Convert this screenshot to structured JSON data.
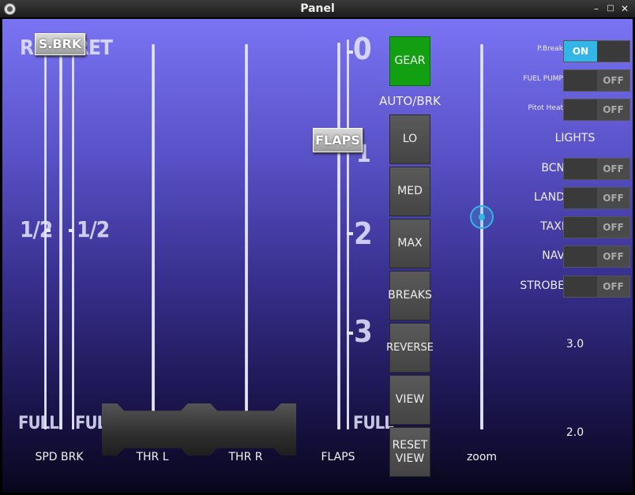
{
  "window": {
    "title": "Panel"
  },
  "speedbrake": {
    "knob": "S.BRK",
    "scale_left": "RET",
    "scale_right": "RET",
    "half_left": "1/2",
    "half_right": "1/2",
    "full_left": "FULL",
    "full_right": "FULL",
    "label": "SPD BRK"
  },
  "throttle": {
    "left_label": "THR L",
    "right_label": "THR R"
  },
  "flaps": {
    "knob": "FLAPS",
    "marks": [
      "0",
      "1",
      "2",
      "3"
    ],
    "full": "FULL",
    "label": "FLAPS"
  },
  "buttons": {
    "gear": "GEAR",
    "autobrk_label": "AUTO/BRK",
    "lo": "LO",
    "med": "MED",
    "max": "MAX",
    "breaks": "BREAKS",
    "reverse": "REVERSE",
    "view": "VIEW",
    "reset_view": "RESET VIEW"
  },
  "zoom": {
    "label": "zoom",
    "value_top": "3.0",
    "value_bottom": "2.0"
  },
  "switches": {
    "pbreak": {
      "label": "P.Break",
      "on": "ON"
    },
    "fuel": {
      "label": "FUEL PUMP",
      "off": "OFF"
    },
    "pitot": {
      "label": "Pitot Heat",
      "off": "OFF"
    },
    "lights_header": "LIGHTS",
    "bcn": {
      "label": "BCN",
      "off": "OFF"
    },
    "land": {
      "label": "LAND",
      "off": "OFF"
    },
    "taxi": {
      "label": "TAXI",
      "off": "OFF"
    },
    "nav": {
      "label": "NAV",
      "off": "OFF"
    },
    "strobe": {
      "label": "STROBE",
      "off": "OFF"
    }
  },
  "colors": {
    "gear": "#12a012",
    "switch_on": "#33b5e5",
    "zoom_accent": "#33b5e5"
  }
}
